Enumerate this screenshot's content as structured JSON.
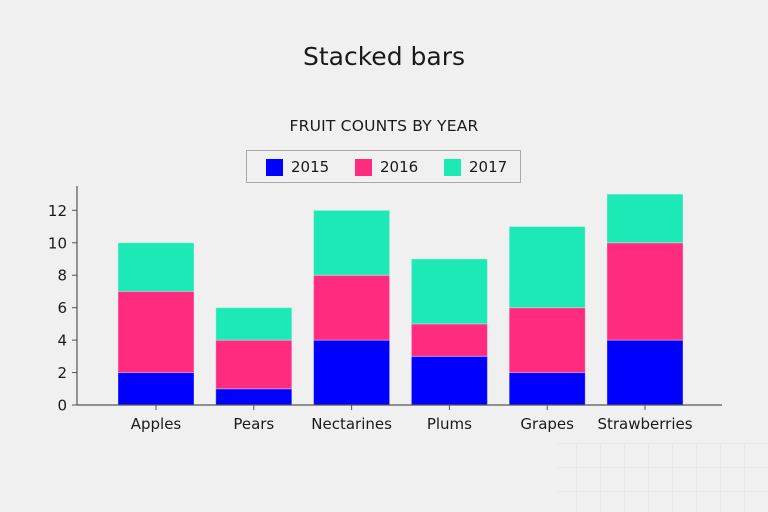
{
  "page": {
    "title": "Stacked bars"
  },
  "chart_data": {
    "type": "bar",
    "stacked": true,
    "title": "FRUIT COUNTS BY YEAR",
    "xlabel": "",
    "ylabel": "",
    "categories": [
      "Apples",
      "Pears",
      "Nectarines",
      "Plums",
      "Grapes",
      "Strawberries"
    ],
    "series": [
      {
        "name": "2015",
        "color": "#0000ff",
        "values": [
          2,
          1,
          4,
          3,
          2,
          4
        ]
      },
      {
        "name": "2016",
        "color": "#ff2b7e",
        "values": [
          5,
          3,
          4,
          2,
          4,
          6
        ]
      },
      {
        "name": "2017",
        "color": "#1de9b6",
        "values": [
          3,
          2,
          4,
          4,
          5,
          3
        ]
      }
    ],
    "ylim": [
      0,
      13.5
    ],
    "yticks": [
      0,
      2,
      4,
      6,
      8,
      10,
      12
    ],
    "grid": false,
    "legend_position": "top-center"
  }
}
